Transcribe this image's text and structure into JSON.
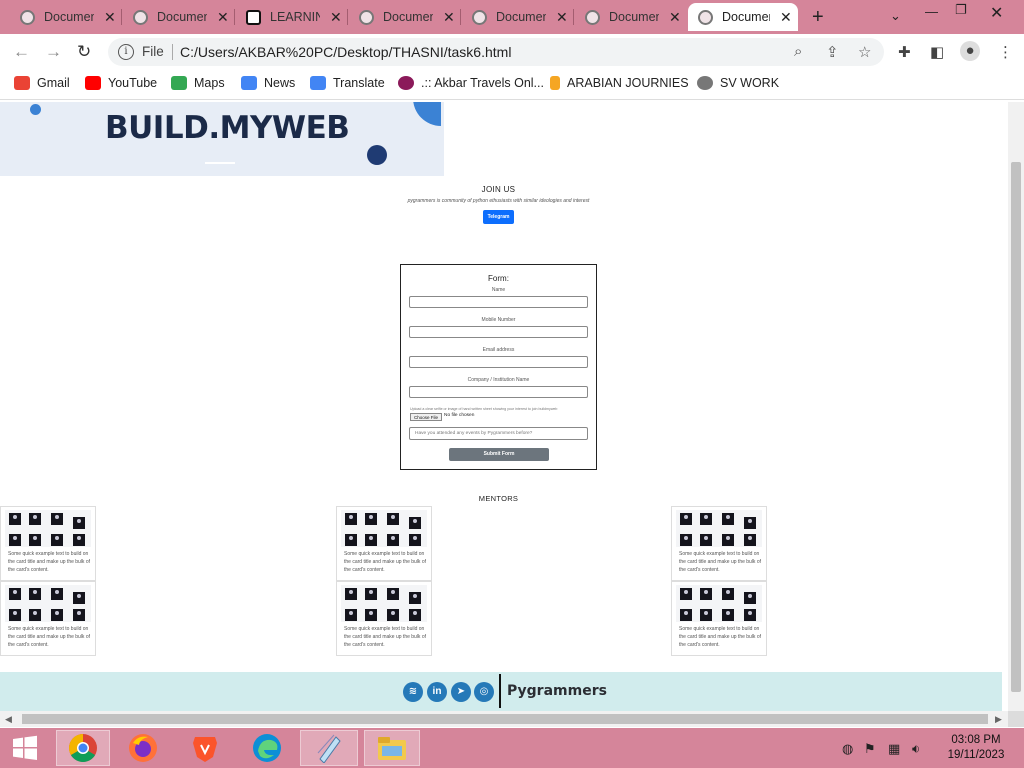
{
  "browser": {
    "tabs": [
      {
        "label": "Document",
        "active": false
      },
      {
        "label": "Document",
        "active": false
      },
      {
        "label": "LEARNING",
        "active": false
      },
      {
        "label": "Document",
        "active": false
      },
      {
        "label": "Document",
        "active": false
      },
      {
        "label": "Document",
        "active": false
      },
      {
        "label": "Document",
        "active": true
      }
    ],
    "new_tab": "+",
    "address": {
      "scheme": "File",
      "url": "C:/Users/AKBAR%20PC/Desktop/THASNI/task6.html"
    },
    "bookmarks": [
      {
        "label": "Gmail",
        "icon": "gmail-icon",
        "color": "#ea4335"
      },
      {
        "label": "YouTube",
        "icon": "youtube-icon",
        "color": "#ff0000"
      },
      {
        "label": "Maps",
        "icon": "maps-icon",
        "color": "#34a853"
      },
      {
        "label": "News",
        "icon": "news-icon",
        "color": "#4285f4"
      },
      {
        "label": "Translate",
        "icon": "translate-icon",
        "color": "#4285f4"
      },
      {
        "label": ".:: Akbar Travels Onl...",
        "icon": "akbar-icon",
        "color": "#8b1a5a"
      },
      {
        "label": "ARABIAN JOURNIES",
        "icon": "arabian-icon",
        "color": "#f5a623"
      },
      {
        "label": "SV WORK",
        "icon": "svwork-icon",
        "color": "#666666"
      }
    ]
  },
  "page": {
    "logo": "BUILD.MYWEB",
    "join": {
      "title": "JOIN US",
      "subtitle": "pygrammers is community of python ethusiasts with similar ideologies and interest",
      "button": "Telegram"
    },
    "form": {
      "title": "Form:",
      "fields": [
        {
          "label": "Name"
        },
        {
          "label": "Mobile Number"
        },
        {
          "label": "Email address"
        },
        {
          "label": "Company / Institution Name"
        }
      ],
      "upload_hint": "Upload a clear selfie or image of hand written sheet showing your interest to join buildmyweb",
      "choose_file": "Choose File",
      "no_file": "No file chosen",
      "attended_placeholder": "Have you attended any events by Pygrammers before?",
      "submit": "Submit Form"
    },
    "mentors": {
      "title": "MENTORS",
      "card_text": "Some quick example text to build on the card title and make up the bulk of the card's content.",
      "card_count": 6
    },
    "footer": {
      "brand": "Pygrammers",
      "social": [
        "spotify-icon",
        "linkedin-icon",
        "telegram-icon",
        "instagram-icon"
      ]
    }
  },
  "taskbar": {
    "time": "03:08 PM",
    "date": "19/11/2023",
    "apps": [
      "start-icon",
      "chrome-icon",
      "firefox-icon",
      "brave-icon",
      "edge-icon",
      "notepad-icon",
      "explorer-icon"
    ]
  },
  "colors": {
    "chrome_frame": "#d5859a",
    "telegram_button": "#0d6efd",
    "submit_button": "#6c757d",
    "footer_bg": "#d1eced",
    "logo_text": "#1b2a48"
  }
}
